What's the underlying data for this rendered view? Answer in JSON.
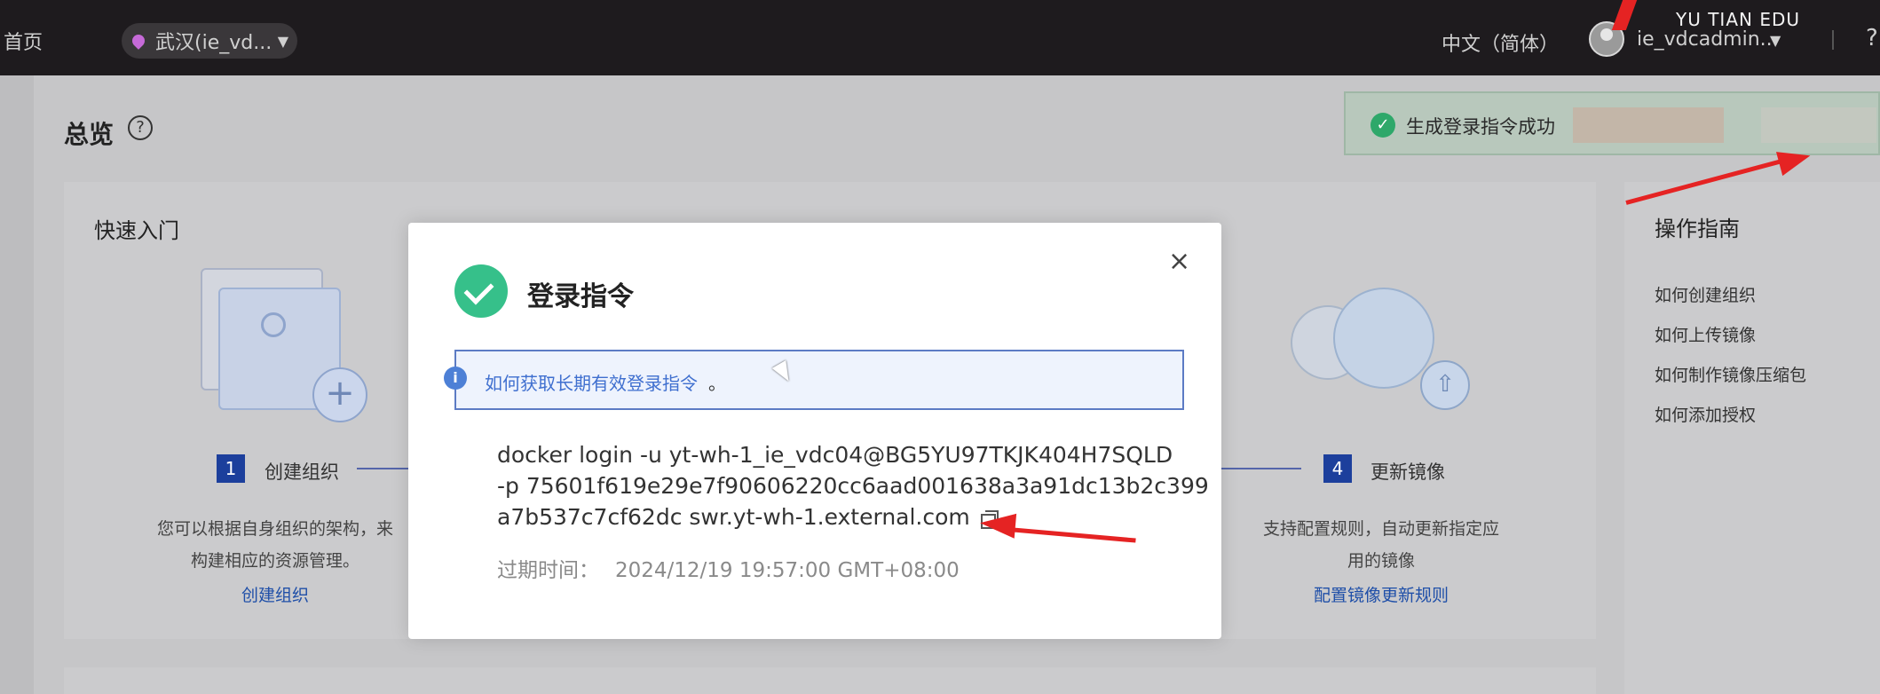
{
  "topbar": {
    "home": "首页",
    "region": "武汉(ie_vd...",
    "language": "中文（简体）",
    "user": "ie_vdcadmin...",
    "help": "?",
    "watermark": "YU TIAN EDU"
  },
  "page": {
    "title": "总览",
    "help": "?"
  },
  "toast": {
    "message": "生成登录指令成功"
  },
  "quickstart": {
    "title": "快速入门",
    "steps": [
      {
        "num": "1",
        "label": "创建组织",
        "desc_line1": "您可以根据自身组织的架构，来",
        "desc_line2": "构建相应的资源管理。",
        "link": "创建组织"
      },
      {
        "num": "4",
        "label": "更新镜像",
        "desc_line1": "支持配置规则，自动更新指定应",
        "desc_line2": "用的镜像",
        "link": "配置镜像更新规则"
      }
    ]
  },
  "guide": {
    "title": "操作指南",
    "links": [
      "如何创建组织",
      "如何上传镜像",
      "如何制作镜像压缩包",
      "如何添加授权"
    ]
  },
  "modal": {
    "title": "登录指令",
    "close": "×",
    "info_icon": "i",
    "info_link": "如何获取长期有效登录指令",
    "info_period": "。",
    "command_line1": "docker login -u yt-wh-1_ie_vdc04@BG5YU97TKJK404H7SQLD",
    "command_line2": "-p 75601f619e29e7f90606220cc6aad001638a3a91dc13b2c399",
    "command_line3": "a7b537c7cf62dc swr.yt-wh-1.external.com",
    "expire_label": "过期时间：",
    "expire_value": "2024/12/19 19:57:00 GMT+08:00"
  },
  "colors": {
    "topbar": "#1e1b1e",
    "success": "#36c08a",
    "link": "#3f6fcf",
    "annotation": "#e52323"
  }
}
